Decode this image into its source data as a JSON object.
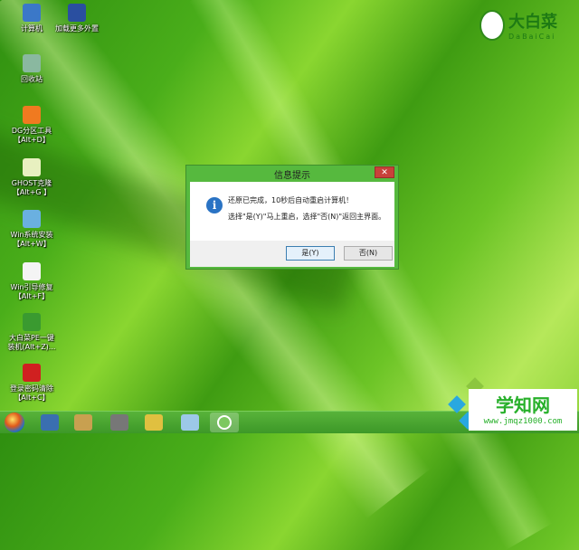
{
  "desktop": {
    "icons": [
      {
        "label": "计算机",
        "sub": "",
        "icon": "computer-icon",
        "color": "#3b78c8"
      },
      {
        "label": "加载更多外置",
        "sub": "",
        "icon": "network-icon",
        "color": "#2a4fa0"
      },
      {
        "label": "回收站",
        "sub": "",
        "icon": "recycle-bin-icon",
        "color": "#8ab8a0"
      },
      {
        "label": "DG分区工具",
        "sub": "【Alt+D】",
        "icon": "diskgenius-icon",
        "color": "#f07a20"
      },
      {
        "label": "GHOST克隆",
        "sub": "【Alt+G 】",
        "icon": "ghost-icon",
        "color": "#e8f0c0"
      },
      {
        "label": "Win系统安装",
        "sub": "【Alt+W】",
        "icon": "windows-install-icon",
        "color": "#6ab0e0"
      },
      {
        "label": "Win引导修复",
        "sub": "【Alt+F】",
        "icon": "boot-repair-icon",
        "color": "#f4f4f4"
      },
      {
        "label": "大白菜PE一键",
        "sub": "装机(Alt+Z)...",
        "icon": "dabaicai-install-icon",
        "color": "#3a9a30"
      },
      {
        "label": "登录密码清除",
        "sub": "【Alt+C】",
        "icon": "password-clear-icon",
        "color": "#d02020"
      }
    ]
  },
  "logo": {
    "cn": "大白菜",
    "en": "DaBaiCai"
  },
  "dialog": {
    "title": "信息提示",
    "line1": "还原已完成，10秒后自动重启计算机！",
    "line2": "选择\"是(Y)\"马上重启，选择\"否(N)\"返回主界面。",
    "yes": "是(Y)",
    "no": "否(N)",
    "close": "✕",
    "info": "i"
  },
  "taskbar": {
    "items": [
      {
        "icon": "display-icon",
        "color": "#3a6fb0"
      },
      {
        "icon": "tools-icon",
        "color": "#c8a050"
      },
      {
        "icon": "memory-icon",
        "color": "#777777"
      },
      {
        "icon": "partition-icon",
        "color": "#e0c040"
      },
      {
        "icon": "notepad-icon",
        "color": "#9cc8e8"
      },
      {
        "icon": "dabaicai-icon",
        "color": "#7cc860"
      }
    ]
  },
  "watermark": {
    "title": "学知网",
    "url": "www.jmqz1000.com"
  }
}
